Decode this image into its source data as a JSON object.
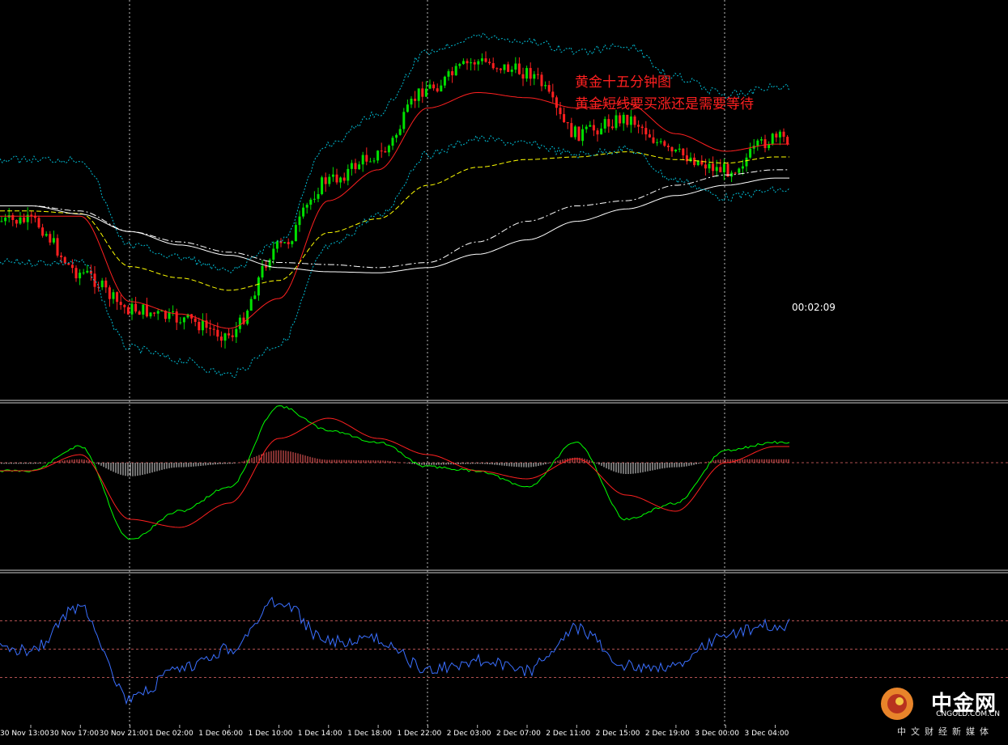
{
  "annotation": {
    "line1": "黄金十五分钟图",
    "line2": "黄金短线要买涨还是需要等待"
  },
  "countdown": "00:02:09",
  "logo": {
    "name": "中金网",
    "url": "CNGOLD.COM.CN",
    "tagline": "中文财经新媒体"
  },
  "colors": {
    "bull": "#00e000",
    "bear": "#ff2020",
    "ma_fast": "#ff2020",
    "ma_mid": "#ffff00",
    "ma_slow": "#ffffff",
    "bands": "#00bcd4",
    "macd_line": "#00ff00",
    "macd_signal": "#ff2020",
    "rsi": "#3a6fff",
    "levels": "#b05050"
  },
  "chart_data": [
    {
      "type": "line",
      "panel": "price",
      "instrument": "gold 15-minute candlestick",
      "categories": [
        "30 Nov 13:00",
        "30 Nov 17:00",
        "30 Nov 21:00",
        "1 Dec 02:00",
        "1 Dec 06:00",
        "1 Dec 10:00",
        "1 Dec 14:00",
        "1 Dec 18:00",
        "1 Dec 22:00",
        "2 Dec 03:00",
        "2 Dec 07:00",
        "2 Dec 11:00",
        "2 Dec 15:00",
        "2 Dec 19:00",
        "3 Dec 00:00",
        "3 Dec 04:00"
      ],
      "series": [
        {
          "values": [
            170,
            120,
            85,
            75,
            60,
            145,
            210,
            235,
            300,
            325,
            315,
            255,
            270,
            235,
            220,
            250
          ]
        },
        {
          "values": [
            175,
            175,
            92,
            80,
            66,
            95,
            190,
            220,
            280,
            295,
            290,
            280,
            285,
            255,
            238,
            245
          ]
        },
        {
          "values": [
            185,
            180,
            160,
            150,
            140,
            130,
            128,
            125,
            130,
            150,
            170,
            185,
            190,
            205,
            215,
            220
          ]
        },
        {
          "values": [
            185,
            177,
            160,
            147,
            137,
            125,
            121,
            120,
            125,
            138,
            152,
            170,
            182,
            195,
            205,
            212
          ]
        }
      ],
      "ylim": [
        0,
        1
      ],
      "grid": true
    },
    {
      "type": "bar",
      "panel": "macd",
      "series": [
        {
          "values": [
            -0.1,
            0.2,
            -0.95,
            -0.6,
            -0.3,
            0.7,
            0.4,
            0.25,
            -0.05,
            -0.1,
            -0.3,
            0.25,
            -0.7,
            -0.5,
            0.15,
            0.25
          ]
        },
        {
          "values": [
            -0.1,
            0.1,
            -0.7,
            -0.8,
            -0.5,
            0.3,
            0.55,
            0.3,
            0.1,
            -0.1,
            -0.2,
            0.05,
            -0.4,
            -0.6,
            0.0,
            0.2
          ]
        }
      ],
      "ylim": [
        -1,
        1
      ]
    },
    {
      "type": "line",
      "panel": "rsi",
      "series": [
        {
          "values": [
            50,
            80,
            14,
            35,
            50,
            84,
            55,
            57,
            35,
            42,
            35,
            65,
            38,
            38,
            61,
            67
          ]
        }
      ],
      "levels": [
        70,
        50,
        30
      ],
      "ylim": [
        0,
        100
      ]
    }
  ]
}
